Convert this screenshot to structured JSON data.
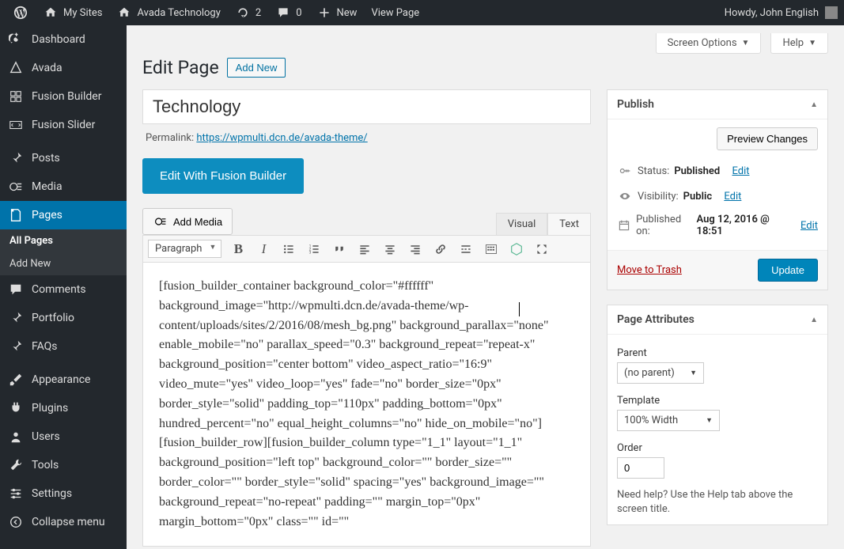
{
  "topbar": {
    "mysites": "My Sites",
    "sitename": "Avada Technology",
    "update_count": "2",
    "comment_count": "0",
    "new": "New",
    "view_page": "View Page",
    "greeting": "Howdy, John English"
  },
  "sidebar": {
    "dashboard": "Dashboard",
    "avada": "Avada",
    "fusion_builder": "Fusion Builder",
    "fusion_slider": "Fusion Slider",
    "posts": "Posts",
    "media": "Media",
    "pages": "Pages",
    "all_pages": "All Pages",
    "pages_add_new": "Add New",
    "comments": "Comments",
    "portfolio": "Portfolio",
    "faqs": "FAQs",
    "appearance": "Appearance",
    "plugins": "Plugins",
    "users": "Users",
    "tools": "Tools",
    "settings": "Settings",
    "collapse": "Collapse menu"
  },
  "screen_opts": {
    "screen_options": "Screen Options",
    "help": "Help"
  },
  "header": {
    "title": "Edit Page",
    "add_new": "Add New"
  },
  "main": {
    "title_value": "Technology",
    "permalink_label": "Permalink: ",
    "permalink_url": "https://wpmulti.dcn.de/avada-theme/",
    "fusion_button": "Edit With Fusion Builder",
    "add_media": "Add Media",
    "tab_visual": "Visual",
    "tab_text": "Text",
    "format_select": "Paragraph",
    "body": "[fusion_builder_container background_color=\"#ffffff\" background_image=\"http://wpmulti.dcn.de/avada-theme/wp-content/uploads/sites/2/2016/08/mesh_bg.png\" background_parallax=\"none\" enable_mobile=\"no\" parallax_speed=\"0.3\" background_repeat=\"repeat-x\" background_position=\"center bottom\" video_aspect_ratio=\"16:9\" video_mute=\"yes\" video_loop=\"yes\" fade=\"no\" border_size=\"0px\" border_style=\"solid\" padding_top=\"110px\" padding_bottom=\"0px\" hundred_percent=\"no\" equal_height_columns=\"no\" hide_on_mobile=\"no\"][fusion_builder_row][fusion_builder_column type=\"1_1\" layout=\"1_1\" background_position=\"left top\" background_color=\"\" border_size=\"\" border_color=\"\" border_style=\"solid\" spacing=\"yes\" background_image=\"\" background_repeat=\"no-repeat\" padding=\"\" margin_top=\"0px\" margin_bottom=\"0px\" class=\"\" id=\"\""
  },
  "publish": {
    "heading": "Publish",
    "preview": "Preview Changes",
    "status_label": "Status: ",
    "status_value": "Published",
    "status_edit": "Edit",
    "visibility_label": "Visibility: ",
    "visibility_value": "Public",
    "visibility_edit": "Edit",
    "published_label": "Published on: ",
    "published_value": "Aug 12, 2016 @ 18:51",
    "published_edit": "Edit",
    "trash": "Move to Trash",
    "update": "Update"
  },
  "attrs": {
    "heading": "Page Attributes",
    "parent_label": "Parent",
    "parent_value": "(no parent)",
    "template_label": "Template",
    "template_value": "100% Width",
    "order_label": "Order",
    "order_value": "0",
    "help": "Need help? Use the Help tab above the screen title."
  }
}
